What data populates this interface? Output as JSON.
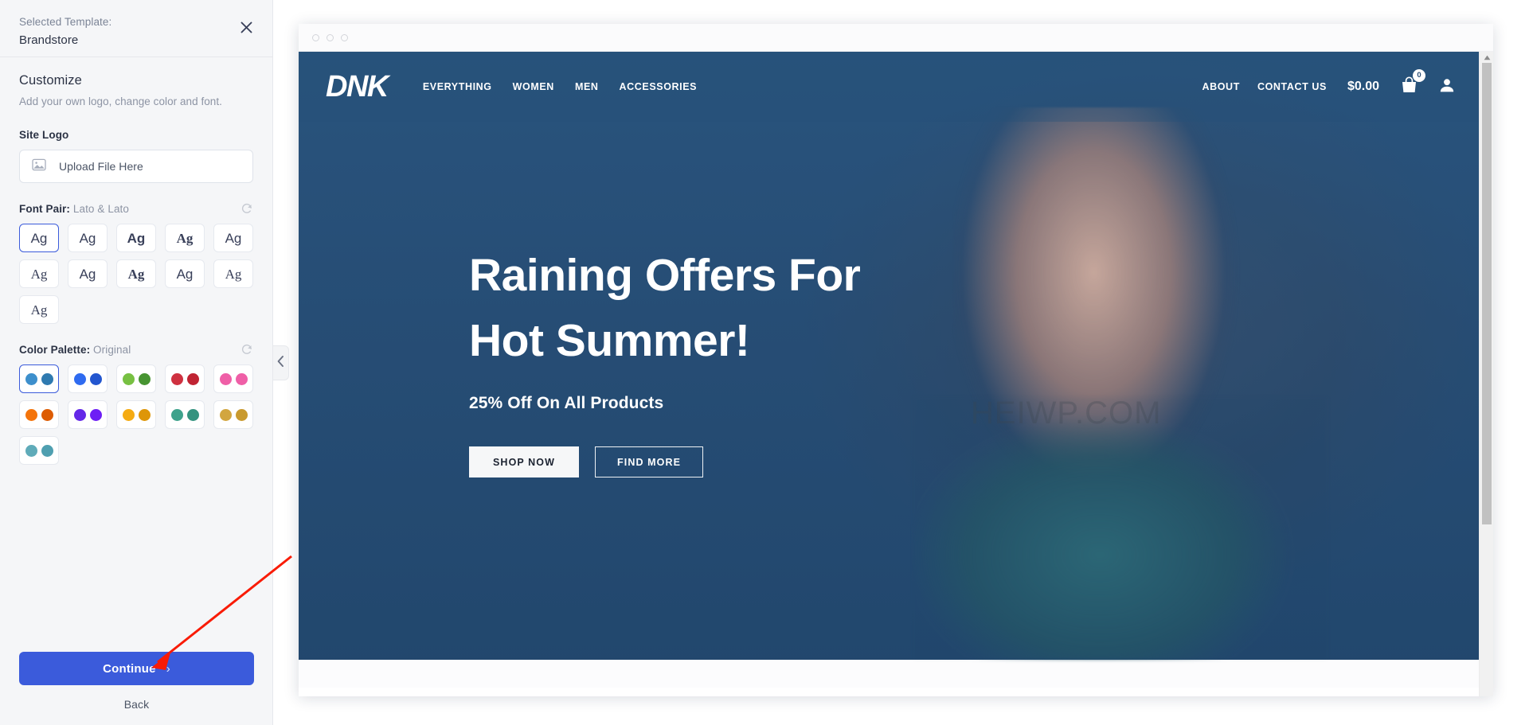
{
  "sidebar": {
    "selected_template_label": "Selected Template:",
    "template_name": "Brandstore",
    "close_icon": "close-icon",
    "customize_title": "Customize",
    "customize_subtitle": "Add your own logo, change color and font.",
    "site_logo_label": "Site Logo",
    "upload": {
      "icon": "image-icon",
      "text": "Upload File Here"
    },
    "font_pair": {
      "label": "Font Pair:",
      "value": "Lato & Lato",
      "refresh_icon": "refresh-icon",
      "sample_text": "Ag",
      "options": [
        {
          "id": "font-1",
          "sample": "Ag",
          "family": "f-sans",
          "weight": "",
          "selected": true
        },
        {
          "id": "font-2",
          "sample": "Ag",
          "family": "f-sans",
          "weight": "",
          "selected": false
        },
        {
          "id": "font-3",
          "sample": "Ag",
          "family": "f-sans",
          "weight": "f-bold",
          "selected": false
        },
        {
          "id": "font-4",
          "sample": "Ag",
          "family": "f-serif",
          "weight": "f-bold",
          "selected": false
        },
        {
          "id": "font-5",
          "sample": "Ag",
          "family": "f-sans",
          "weight": "",
          "selected": false
        },
        {
          "id": "font-6",
          "sample": "Ag",
          "family": "f-serif",
          "weight": "",
          "selected": false
        },
        {
          "id": "font-7",
          "sample": "Ag",
          "family": "f-sans",
          "weight": "",
          "selected": false
        },
        {
          "id": "font-8",
          "sample": "Ag",
          "family": "f-serif",
          "weight": "f-bold",
          "selected": false
        },
        {
          "id": "font-9",
          "sample": "Ag",
          "family": "f-sans",
          "weight": "",
          "selected": false
        },
        {
          "id": "font-10",
          "sample": "Ag",
          "family": "f-serif",
          "weight": "",
          "selected": false
        },
        {
          "id": "font-11",
          "sample": "Ag",
          "family": "f-serif",
          "weight": "",
          "selected": false
        }
      ]
    },
    "color_palette": {
      "label": "Color Palette:",
      "value": "Original",
      "refresh_icon": "refresh-icon",
      "options": [
        {
          "id": "pal-original",
          "colors": [
            "#3d8fcc",
            "#2f7ab0"
          ],
          "selected": true
        },
        {
          "id": "pal-blue",
          "colors": [
            "#2f6bf0",
            "#2356cf"
          ],
          "selected": false
        },
        {
          "id": "pal-green",
          "colors": [
            "#77c042",
            "#479432"
          ],
          "selected": false
        },
        {
          "id": "pal-red",
          "colors": [
            "#cf3140",
            "#c02433"
          ],
          "selected": false
        },
        {
          "id": "pal-pink",
          "colors": [
            "#ef5fa7",
            "#ef5fa7"
          ],
          "selected": false
        },
        {
          "id": "pal-orange",
          "colors": [
            "#f4740b",
            "#dd5c03"
          ],
          "selected": false
        },
        {
          "id": "pal-purple",
          "colors": [
            "#6428e8",
            "#6d1ef5"
          ],
          "selected": false
        },
        {
          "id": "pal-amber",
          "colors": [
            "#f5ab12",
            "#de9608",
            "#d9a23f"
          ],
          "selected": false
        },
        {
          "id": "pal-teal",
          "colors": [
            "#3ea28c",
            "#34937f"
          ],
          "selected": false
        },
        {
          "id": "pal-gold",
          "colors": [
            "#d2a63f",
            "#c99a2e"
          ],
          "selected": false
        },
        {
          "id": "pal-skyteal",
          "colors": [
            "#5fabb9",
            "#4f9fb0"
          ],
          "selected": false
        }
      ]
    },
    "continue_button": "Continue",
    "continue_chevron": "chevron-right-icon",
    "back_link": "Back",
    "collapse_icon": "chevron-left-icon"
  },
  "preview": {
    "browser_dots": [
      "dot-1",
      "dot-2",
      "dot-3"
    ],
    "site": {
      "logo": "DNK",
      "nav_links": [
        "EVERYTHING",
        "WOMEN",
        "MEN",
        "ACCESSORIES"
      ],
      "nav_right_links": [
        "ABOUT",
        "CONTACT US"
      ],
      "cart_total": "$0.00",
      "cart_count": "0",
      "cart_icon": "shopping-bag-icon",
      "account_icon": "user-icon",
      "hero": {
        "title_line1": "Raining Offers For",
        "title_line2": "Hot Summer!",
        "subtitle": "25% Off On All Products",
        "primary_button": "SHOP NOW",
        "secondary_button": "FIND MORE"
      },
      "watermark": "HEIWP.COM"
    },
    "scrollbar": {
      "up_arrow_icon": "caret-up-icon"
    }
  },
  "colors": {
    "accent": "#3b5bdb",
    "sidebar_bg": "#f5f6f8",
    "hero_blue": "#2b5078",
    "annotation_arrow": "#f91b05"
  }
}
